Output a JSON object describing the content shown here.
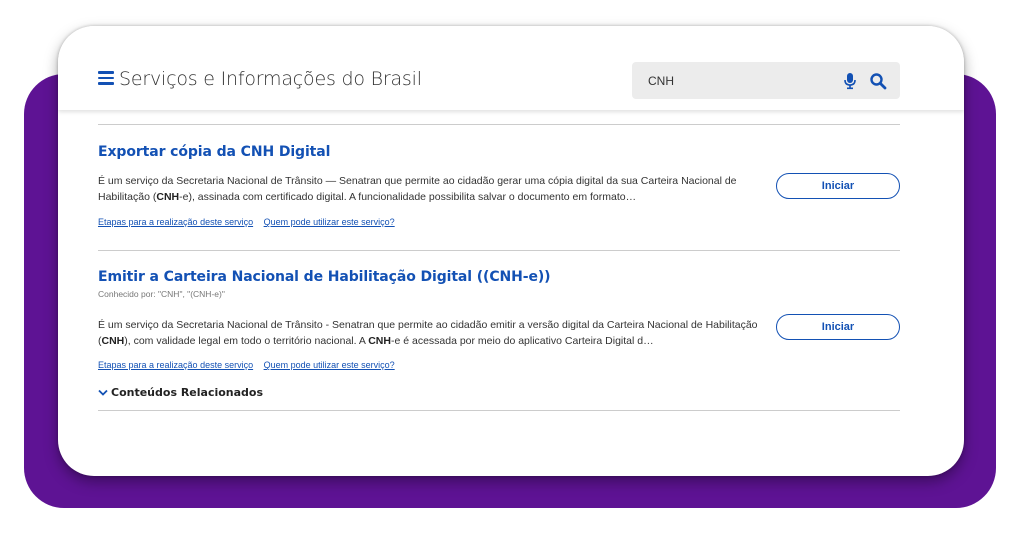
{
  "header": {
    "site_title": "Serviços e Informações do Brasil",
    "search_value": "CNH"
  },
  "results": [
    {
      "title": "Exportar cópia da CNH Digital",
      "desc_part1": "É um serviço da Secretaria Nacional de Trânsito — Senatran que permite ao cidadão gerar uma cópia digital da sua Carteira Nacional de Habilitação (",
      "desc_bold1": "CNH",
      "desc_part2": "-e), assinada com certificado digital. A funcionalidade possibilita salvar o documento em formato…",
      "link_steps": "Etapas para a realização deste serviço",
      "link_who": "Quem pode utilizar este serviço?",
      "button": "Iniciar"
    },
    {
      "title": "Emitir a Carteira Nacional de Habilitação Digital ((CNH-e))",
      "known_as": "Conhecido por: \"CNH\", \"(CNH-e)\"",
      "desc_part1": "É um serviço da Secretaria Nacional de Trânsito - Senatran que permite ao cidadão emitir a versão digital da Carteira Nacional de Habilitação (",
      "desc_bold1": "CNH",
      "desc_part2": "), com validade legal em todo o território nacional. A ",
      "desc_bold2": "CNH",
      "desc_part3": "-e é acessada por meio do aplicativo Carteira Digital d…",
      "link_steps": "Etapas para a realização deste serviço",
      "link_who": "Quem pode utilizar este serviço?",
      "button": "Iniciar"
    }
  ],
  "related_label": "Conteúdos Relacionados",
  "icons": {
    "menu": "hamburger-menu-icon",
    "mic": "microphone-icon",
    "search": "search-icon",
    "chevron": "chevron-down-icon"
  },
  "colors": {
    "brand_blue": "#1351b4",
    "frame_purple": "#5e1394"
  }
}
